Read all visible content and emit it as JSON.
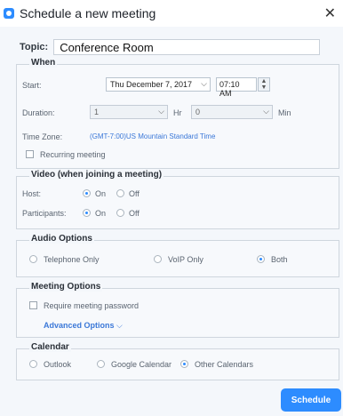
{
  "window": {
    "title": "Schedule a new meeting"
  },
  "topic": {
    "label": "Topic:",
    "value": "Conference Room"
  },
  "when": {
    "title": "When",
    "start_label": "Start:",
    "date_value": "Thu  December  7, 2017",
    "time_value": "07:10 AM",
    "duration_label": "Duration:",
    "duration_hours": "1",
    "hours_unit": "Hr",
    "duration_minutes": "0",
    "minutes_unit": "Min",
    "timezone_label": "Time Zone:",
    "timezone_value": "(GMT-7:00)US Mountain Standard Time",
    "recurring_label": "Recurring meeting"
  },
  "video": {
    "title": "Video (when joining a meeting)",
    "host_label": "Host:",
    "participants_label": "Participants:",
    "on_label": "On",
    "off_label": "Off"
  },
  "audio": {
    "title": "Audio Options",
    "telephone": "Telephone Only",
    "voip": "VoIP Only",
    "both": "Both",
    "selected": "Both"
  },
  "meeting_options": {
    "title": "Meeting Options",
    "require_password": "Require meeting password",
    "advanced": "Advanced Options"
  },
  "calendar": {
    "title": "Calendar",
    "outlook": "Outlook",
    "google": "Google Calendar",
    "other": "Other Calendars",
    "selected": "Other Calendars"
  },
  "actions": {
    "schedule": "Schedule"
  },
  "colors": {
    "accent": "#2d8cff",
    "link": "#3b78d8"
  }
}
